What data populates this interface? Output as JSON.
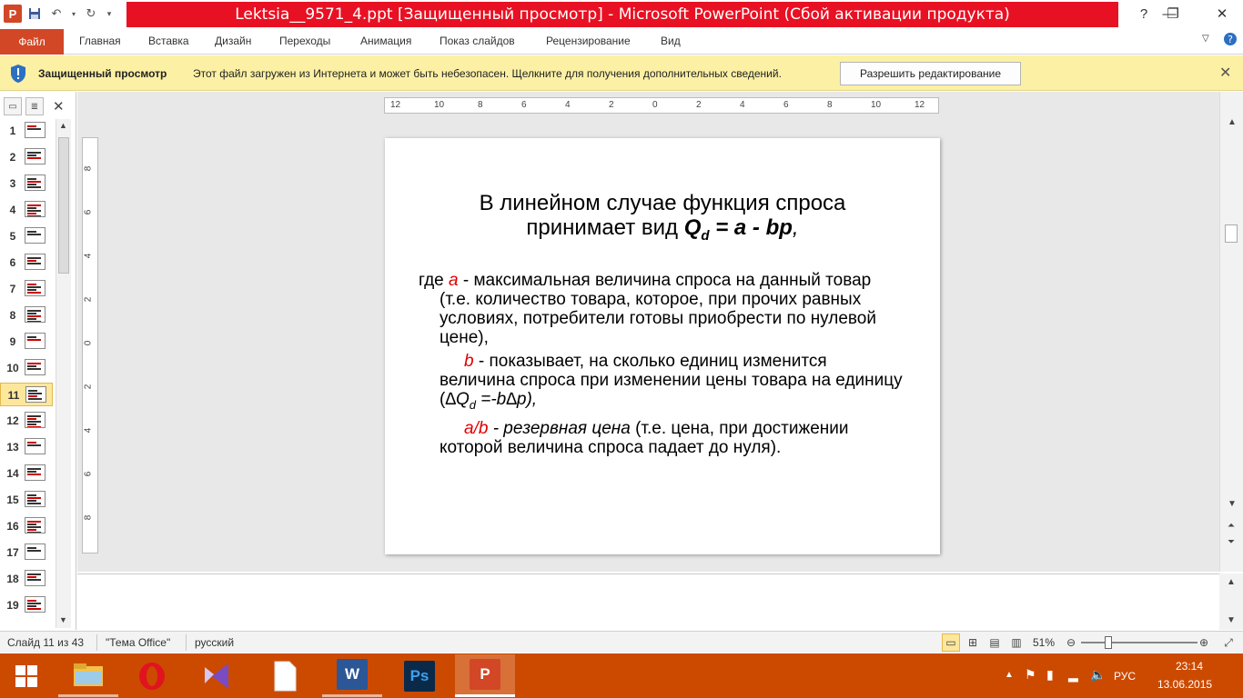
{
  "window": {
    "title": "Lektsia__9571_4.ppt [Защищенный просмотр]  -  Microsoft PowerPoint (Сбой активации продукта)",
    "app_icon_letter": "P"
  },
  "ribbon": {
    "file": "Файл",
    "tabs": [
      "Главная",
      "Вставка",
      "Дизайн",
      "Переходы",
      "Анимация",
      "Показ слайдов",
      "Рецензирование",
      "Вид"
    ]
  },
  "message_bar": {
    "title": "Защищенный просмотр",
    "text": "Этот файл загружен из Интернета и может быть небезопасен. Щелкните для получения дополнительных сведений.",
    "button": "Разрешить редактирование"
  },
  "slides_panel": {
    "slide_numbers": [
      "1",
      "2",
      "3",
      "4",
      "5",
      "6",
      "7",
      "8",
      "9",
      "10",
      "11",
      "12",
      "13",
      "14",
      "15",
      "16",
      "17",
      "18",
      "19"
    ],
    "active_slide": "11"
  },
  "ruler": {
    "horizontal": [
      "12",
      "10",
      "8",
      "6",
      "4",
      "2",
      "0",
      "2",
      "4",
      "6",
      "8",
      "10",
      "12"
    ],
    "vertical": [
      "8",
      "6",
      "4",
      "2",
      "0",
      "2",
      "4",
      "6",
      "8"
    ]
  },
  "slide": {
    "title_line1": "В линейном случае функция спроса",
    "title_line2_prefix": "принимает вид ",
    "title_formula_q": "Q",
    "title_formula_sub": "d",
    "title_formula_rest": " = a - bp",
    "title_tail": ",",
    "p1_lead": "где  ",
    "p1_var": "a",
    "p1_text": " - максимальная величина спроса на данный товар (т.е. количество товара, которое, при прочих равных условиях, потребители готовы приобрести по нулевой цене),",
    "p2_var": "b",
    "p2_text": " - показывает, на сколько единиц изменится величина спроса при изменении цены товара на единицу (",
    "p2_formula_a": "∆Q",
    "p2_formula_sub": "d",
    "p2_formula_b": " =-b∆p",
    "p2_end": "),",
    "p3_var": "a/b",
    "p3_em": " - резервная цена",
    "p3_text": " (т.е. цена, при достижении которой величина спроса падает до нуля)."
  },
  "status_bar": {
    "slide_info": "Слайд 11 из 43",
    "theme": "\"Тема Office\"",
    "language": "русский",
    "zoom": "51%",
    "zoom_value": 51
  },
  "taskbar": {
    "lang": "РУС",
    "time": "23:14",
    "date": "13.06.2015",
    "apps": [
      "file-explorer",
      "opera",
      "visual-studio",
      "blank-document",
      "word",
      "photoshop",
      "powerpoint"
    ],
    "app_letters": {
      "opera": "O",
      "word": "W",
      "photoshop": "Ps"
    }
  },
  "colors": {
    "title_bar_red": "#e81123",
    "file_tab": "#d24726",
    "message_bar": "#fcf0a4",
    "taskbar": "#cc4a00",
    "slide_var_red": "#e00000"
  }
}
